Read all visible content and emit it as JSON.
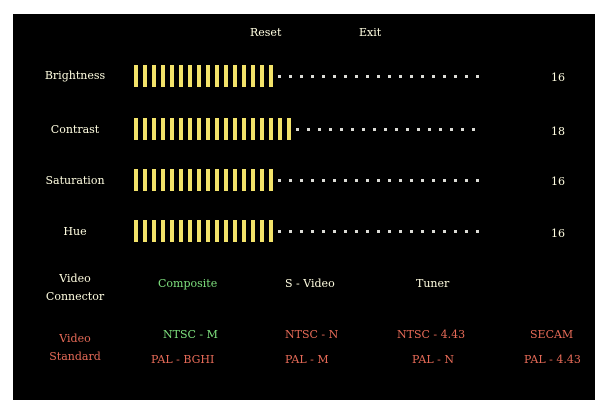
{
  "menu": {
    "reset": "Reset",
    "exit": "Exit"
  },
  "sliders": [
    {
      "label": "Brightness",
      "value": "16",
      "level": 16,
      "total": 35
    },
    {
      "label": "Contrast",
      "value": "18",
      "level": 18,
      "total": 35
    },
    {
      "label": "Saturation",
      "value": "16",
      "level": 16,
      "total": 35
    },
    {
      "label": "Hue",
      "value": "16",
      "level": 16,
      "total": 35
    }
  ],
  "video_connector": {
    "label_line1": "Video",
    "label_line2": "Connector",
    "options": [
      "Composite",
      "S - Video",
      "Tuner"
    ],
    "selected": "Composite"
  },
  "video_standard": {
    "label_line1": "Video",
    "label_line2": "Standard",
    "row1": [
      "NTSC - M",
      "NTSC - N",
      "NTSC - 4.43",
      "SECAM"
    ],
    "row2": [
      "PAL - BGHI",
      "PAL - M",
      "PAL - N",
      "PAL - 4.43"
    ],
    "selected": "NTSC - M"
  },
  "colors": {
    "background": "#000000",
    "bar": "#f3e36a",
    "text": "#fffde0",
    "selected": "#7ee07e",
    "standard": "#e66a57"
  }
}
